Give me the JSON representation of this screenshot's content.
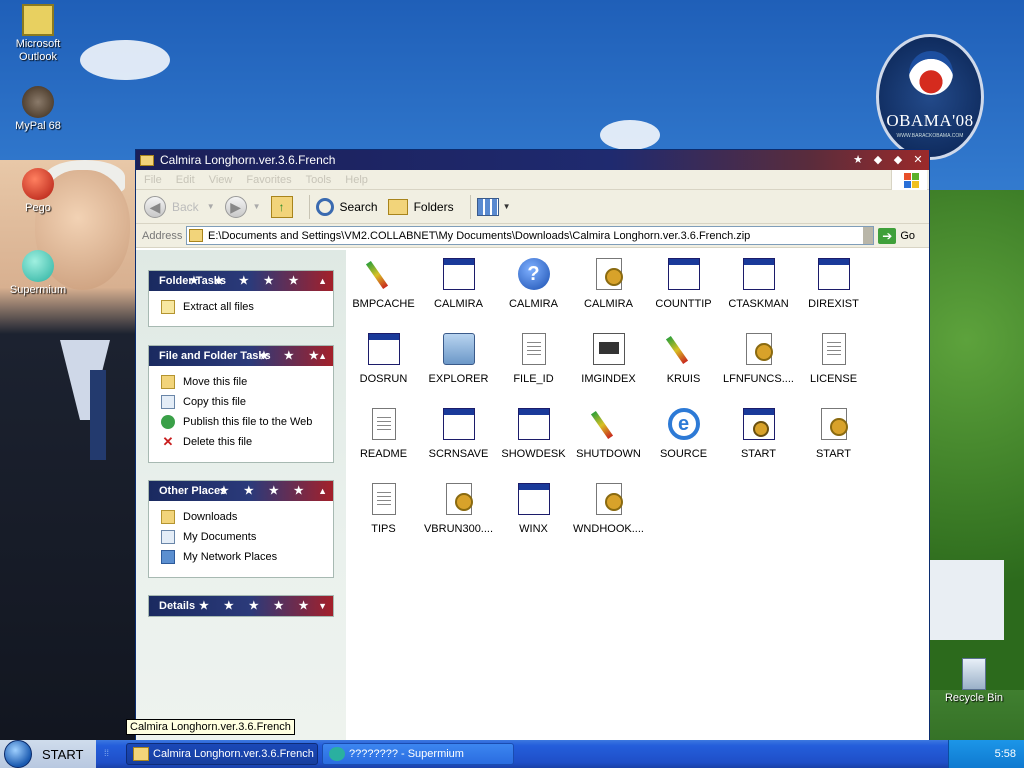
{
  "desktop": {
    "icons": [
      {
        "label": "Microsoft Outlook",
        "icon": "outlook-icon"
      },
      {
        "label": "MyPal 68",
        "icon": "raccoon-icon"
      },
      {
        "label": "Pego",
        "icon": "pego-icon"
      },
      {
        "label": "Supermium",
        "icon": "supermium-icon"
      },
      {
        "label": "Recycle Bin",
        "icon": "recycle-bin-icon"
      }
    ],
    "badge": {
      "text": "OBAMA'08",
      "subtext": "WWW.BARACKOBAMA.COM"
    }
  },
  "window": {
    "title": "Calmira Longhorn.ver.3.6.French",
    "menu": [
      "File",
      "Edit",
      "View",
      "Favorites",
      "Tools",
      "Help"
    ],
    "toolbar": {
      "back": "Back",
      "search": "Search",
      "folders": "Folders"
    },
    "address": {
      "label": "Address",
      "value": "E:\\Documents and Settings\\VM2.COLLABNET\\My Documents\\Downloads\\Calmira Longhorn.ver.3.6.French.zip",
      "go": "Go"
    }
  },
  "taskpane": {
    "folder_tasks": {
      "title": "Folder Tasks",
      "items": [
        "Extract all files"
      ]
    },
    "file_folder_tasks": {
      "title": "File and Folder Tasks",
      "items": [
        "Move this file",
        "Copy this file",
        "Publish this file to the Web",
        "Delete this file"
      ]
    },
    "other_places": {
      "title": "Other Places",
      "items": [
        "Downloads",
        "My Documents",
        "My Network Places"
      ]
    },
    "details": {
      "title": "Details"
    }
  },
  "files": [
    {
      "name": "BMPCACHE",
      "type": "brush"
    },
    {
      "name": "CALMIRA",
      "type": "win"
    },
    {
      "name": "CALMIRA",
      "type": "help"
    },
    {
      "name": "CALMIRA",
      "type": "gear"
    },
    {
      "name": "COUNTTIP",
      "type": "win"
    },
    {
      "name": "CTASKMAN",
      "type": "win"
    },
    {
      "name": "DIREXIST",
      "type": "win"
    },
    {
      "name": "DOSRUN",
      "type": "win"
    },
    {
      "name": "EXPLORER",
      "type": "pc"
    },
    {
      "name": "FILE_ID",
      "type": "page"
    },
    {
      "name": "IMGINDEX",
      "type": "img"
    },
    {
      "name": "KRUIS",
      "type": "brush"
    },
    {
      "name": "LFNFUNCS....",
      "type": "gear"
    },
    {
      "name": "LICENSE",
      "type": "page"
    },
    {
      "name": "README",
      "type": "page"
    },
    {
      "name": "SCRNSAVE",
      "type": "win"
    },
    {
      "name": "SHOWDESK",
      "type": "win"
    },
    {
      "name": "SHUTDOWN",
      "type": "brush"
    },
    {
      "name": "SOURCE",
      "type": "ie"
    },
    {
      "name": "START",
      "type": "setup"
    },
    {
      "name": "START",
      "type": "gear"
    },
    {
      "name": "TIPS",
      "type": "page"
    },
    {
      "name": "VBRUN300....",
      "type": "gear"
    },
    {
      "name": "WINX",
      "type": "win"
    },
    {
      "name": "WNDHOOK....",
      "type": "gear"
    }
  ],
  "tooltip": "Calmira Longhorn.ver.3.6.French",
  "taskbar": {
    "start": "START",
    "buttons": [
      "Calmira Longhorn.ver.3.6.French",
      "???????? - Supermium"
    ],
    "clock": "5:58"
  }
}
